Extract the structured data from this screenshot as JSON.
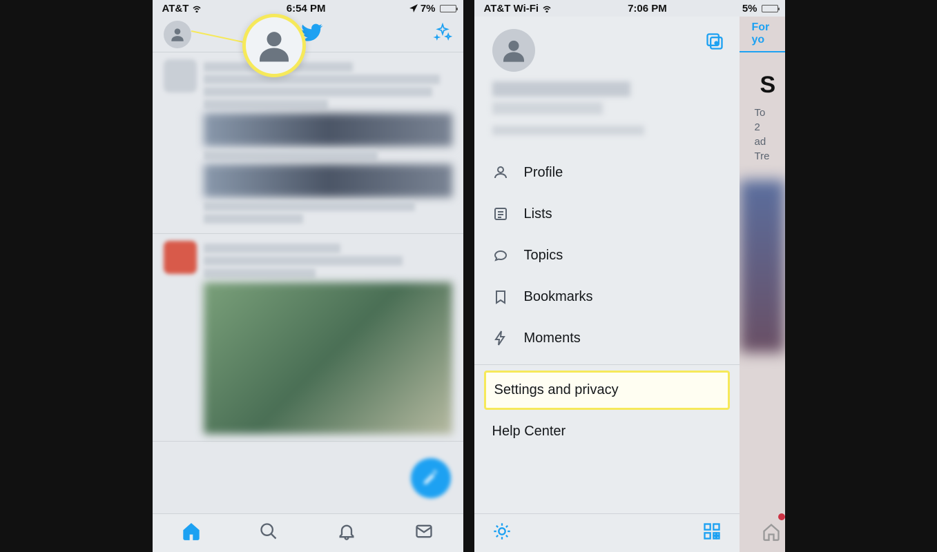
{
  "screen1": {
    "status": {
      "carrier": "AT&T",
      "time": "6:54 PM",
      "battery": "7%"
    },
    "icons": {
      "avatar": "avatar-icon",
      "logo": "twitter-logo-icon",
      "sparkle": "sparkle-icon"
    },
    "tabs": [
      "home",
      "search",
      "notifications",
      "messages"
    ]
  },
  "screen2": {
    "status": {
      "carrier": "AT&T Wi-Fi",
      "time": "7:06 PM",
      "battery": "5%"
    },
    "menu": {
      "profile": "Profile",
      "lists": "Lists",
      "topics": "Topics",
      "bookmarks": "Bookmarks",
      "moments": "Moments",
      "settings": "Settings and privacy",
      "help": "Help Center"
    },
    "behind": {
      "tab_label": "For yo",
      "headline_fragment": "S",
      "line1": "To",
      "line2": "2",
      "line3": "ad",
      "line4": "Tre"
    }
  }
}
